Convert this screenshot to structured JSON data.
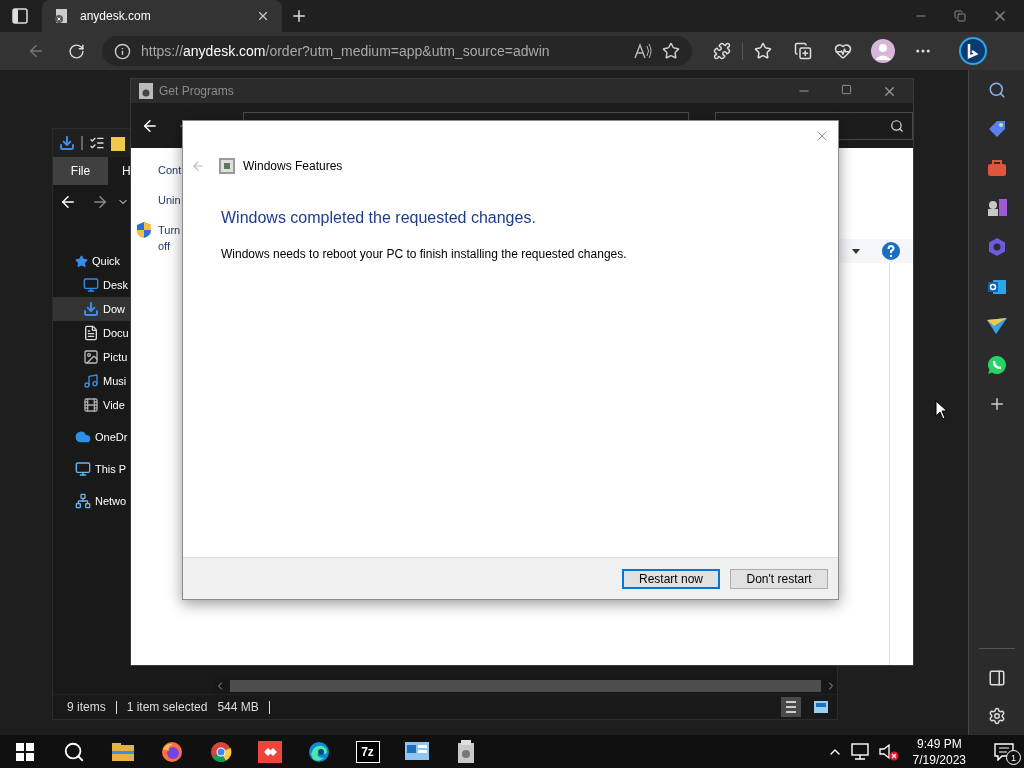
{
  "browser": {
    "tabs": [
      {
        "title": "anydesk.com",
        "selected": true
      }
    ],
    "address": "https://**anydesk.com**/order?utm_medium=app&utm_source=adwin"
  },
  "explorer": {
    "ribbon_tabs": [
      {
        "label": "File",
        "selected": true
      },
      {
        "label": "H",
        "selected": false
      }
    ],
    "navigation": [
      {
        "label": "Quick",
        "kind": "star",
        "selected": false,
        "children": [
          {
            "label": "Desk",
            "kind": "desktop",
            "selected": false
          },
          {
            "label": "Dow",
            "kind": "download",
            "selected": true
          },
          {
            "label": "Docu",
            "kind": "document",
            "selected": false
          },
          {
            "label": "Pictu",
            "kind": "pictures",
            "selected": false
          },
          {
            "label": "Musi",
            "kind": "music",
            "selected": false
          },
          {
            "label": "Vide",
            "kind": "videos",
            "selected": false
          }
        ]
      },
      {
        "label": "OneDr",
        "kind": "cloud",
        "selected": false
      },
      {
        "label": "This P",
        "kind": "computer",
        "selected": false
      },
      {
        "label": "Netwo",
        "kind": "network",
        "selected": false
      }
    ],
    "status_bar": {
      "item_count": "9 items",
      "selection": "1 item selected",
      "size": "544 MB"
    },
    "views": [
      {
        "kind": "details",
        "selected": true
      },
      {
        "kind": "tiles",
        "selected": false
      }
    ]
  },
  "programs_window": {
    "title": "Get Programs",
    "links": [
      {
        "text": "Cont",
        "kind": "plain"
      },
      {
        "text": "Unin",
        "kind": "plain"
      },
      {
        "text": "Turn\noff",
        "kind": "shield"
      }
    ]
  },
  "dialog": {
    "title": "Windows Features",
    "heading": "Windows completed the requested changes.",
    "message": "Windows needs to reboot your PC to finish installing the requested changes.",
    "buttons": [
      {
        "label": "Restart now",
        "default": true
      },
      {
        "label": "Don't restart",
        "default": false
      }
    ]
  },
  "taskbar": {
    "apps": [
      {
        "kind": "explorer"
      },
      {
        "kind": "firefox"
      },
      {
        "kind": "chrome"
      },
      {
        "kind": "anydesk"
      },
      {
        "kind": "edge"
      },
      {
        "kind": "archiver",
        "label": "7z"
      },
      {
        "kind": "control-panel"
      },
      {
        "kind": "installer"
      }
    ],
    "clock": {
      "time": "9:49 PM",
      "date": "7/19/2023"
    },
    "notifications": "1"
  }
}
